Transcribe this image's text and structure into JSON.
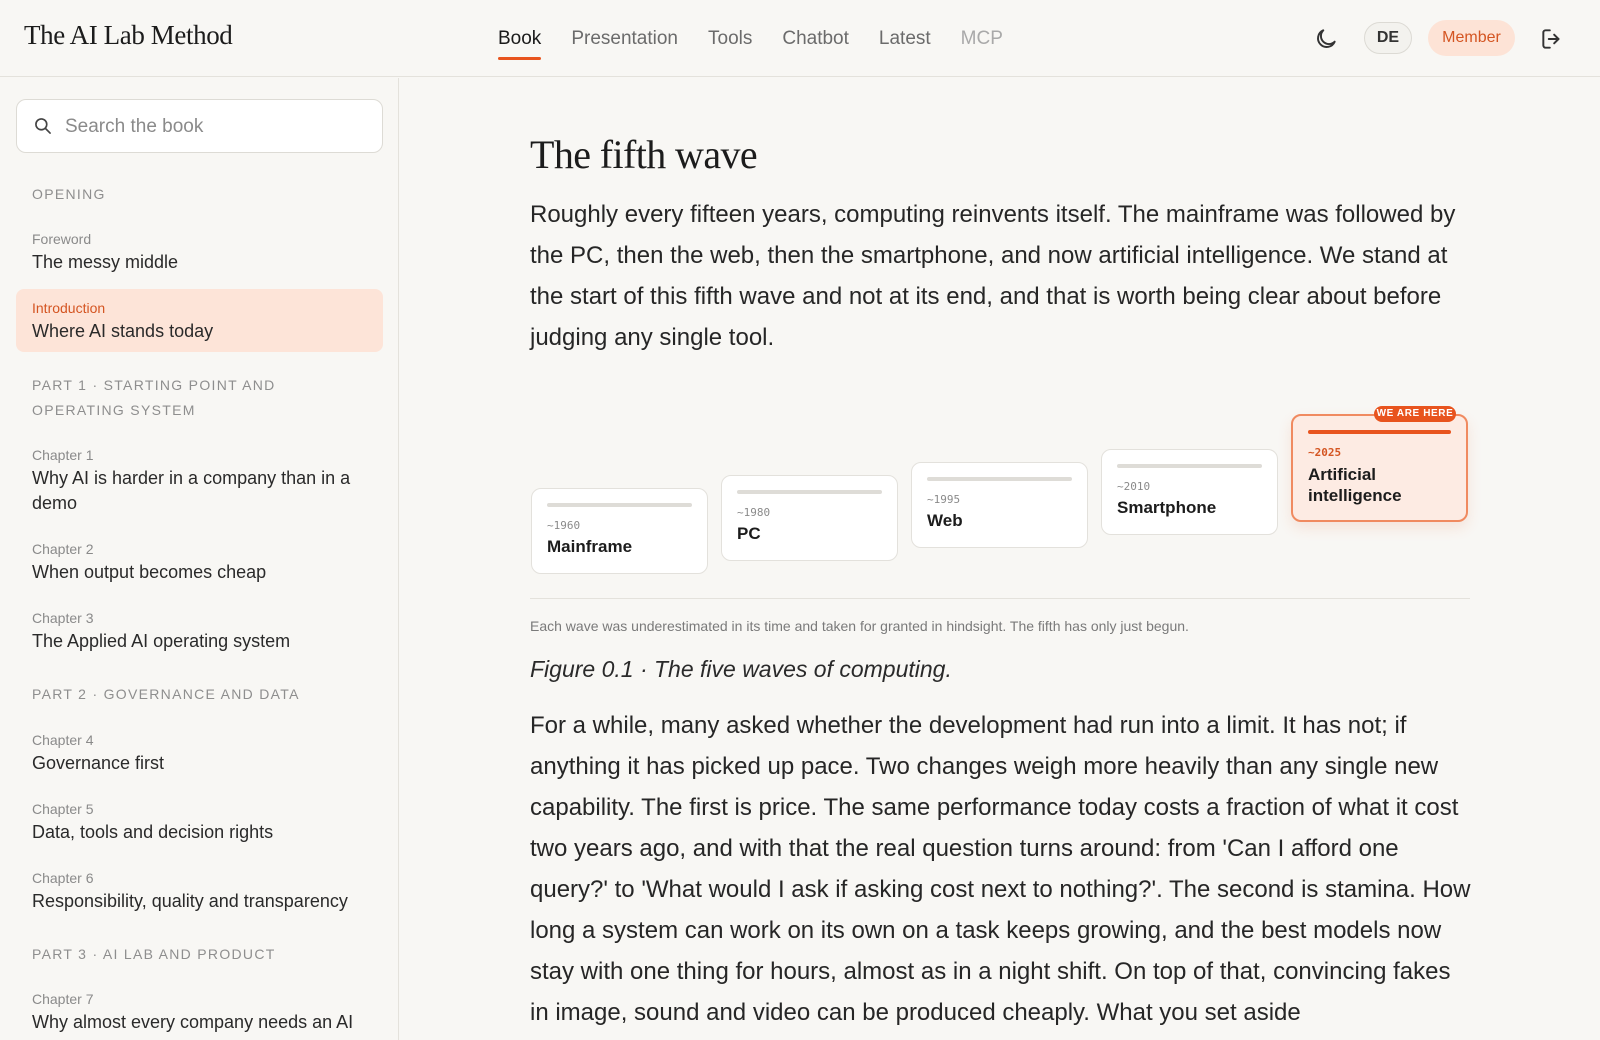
{
  "header": {
    "brand": "The AI Lab Method",
    "nav": [
      {
        "label": "Book",
        "active": true
      },
      {
        "label": "Presentation"
      },
      {
        "label": "Tools"
      },
      {
        "label": "Chatbot"
      },
      {
        "label": "Latest"
      },
      {
        "label": "MCP",
        "muted": true
      }
    ],
    "language": "DE",
    "member": "Member",
    "icons": {
      "theme": "moon-icon",
      "logout": "logout-icon"
    },
    "accent_color": "#e8541e"
  },
  "sidebar": {
    "search": {
      "placeholder": "Search the book"
    },
    "sections": [
      {
        "label": "OPENING"
      },
      {
        "label": "PART 1 · STARTING POINT AND OPERATING SYSTEM"
      },
      {
        "label": "PART 2 · GOVERNANCE AND DATA"
      },
      {
        "label": "PART 3 · AI LAB AND PRODUCT"
      }
    ],
    "items": [
      {
        "kicker": "Foreword",
        "title": "The messy middle"
      },
      {
        "kicker": "Introduction",
        "title": "Where AI stands today",
        "active": true
      },
      {
        "kicker": "Chapter 1",
        "title": "Why AI is harder in a company than in a demo"
      },
      {
        "kicker": "Chapter 2",
        "title": "When output becomes cheap"
      },
      {
        "kicker": "Chapter 3",
        "title": "The Applied AI operating system"
      },
      {
        "kicker": "Chapter 4",
        "title": "Governance first"
      },
      {
        "kicker": "Chapter 5",
        "title": "Data, tools and decision rights"
      },
      {
        "kicker": "Chapter 6",
        "title": "Responsibility, quality and transparency"
      },
      {
        "kicker": "Chapter 7",
        "title": "Why almost every company needs an AI"
      }
    ]
  },
  "main": {
    "title": "The fifth wave",
    "lead": "Roughly every fifteen years, computing reinvents itself. The mainframe was followed by the PC, then the web, then the smartphone, and now artificial intelligence. We stand at the start of this fifth wave and not at its end, and that is worth being clear about before judging any single tool.",
    "figure": {
      "badge": "WE ARE HERE",
      "waves": [
        {
          "year": "~1960",
          "name": "Mainframe"
        },
        {
          "year": "~1980",
          "name": "PC"
        },
        {
          "year": "~1995",
          "name": "Web"
        },
        {
          "year": "~2010",
          "name": "Smartphone"
        },
        {
          "year": "~2025",
          "name": "Artificial intelligence",
          "active": true
        }
      ],
      "note": "Each wave was underestimated in its time and taken for granted in hindsight. The fifth has only just begun.",
      "caption": "Figure 0.1 · The five waves of computing."
    },
    "body": "For a while, many asked whether the development had run into a limit. It has not; if anything it has picked up pace. Two changes weigh more heavily than any single new capability. The first is price. The same performance today costs a fraction of what it cost two years ago, and with that the real question turns around: from 'Can I afford one query?' to 'What would I ask if asking cost next to nothing?'. The second is stamina. How long a system can work on its own on a task keeps growing, and the best models now stay with one thing for hours, almost as in a night shift. On top of that, convincing fakes in image, sound and video can be produced cheaply. What you set aside"
  }
}
